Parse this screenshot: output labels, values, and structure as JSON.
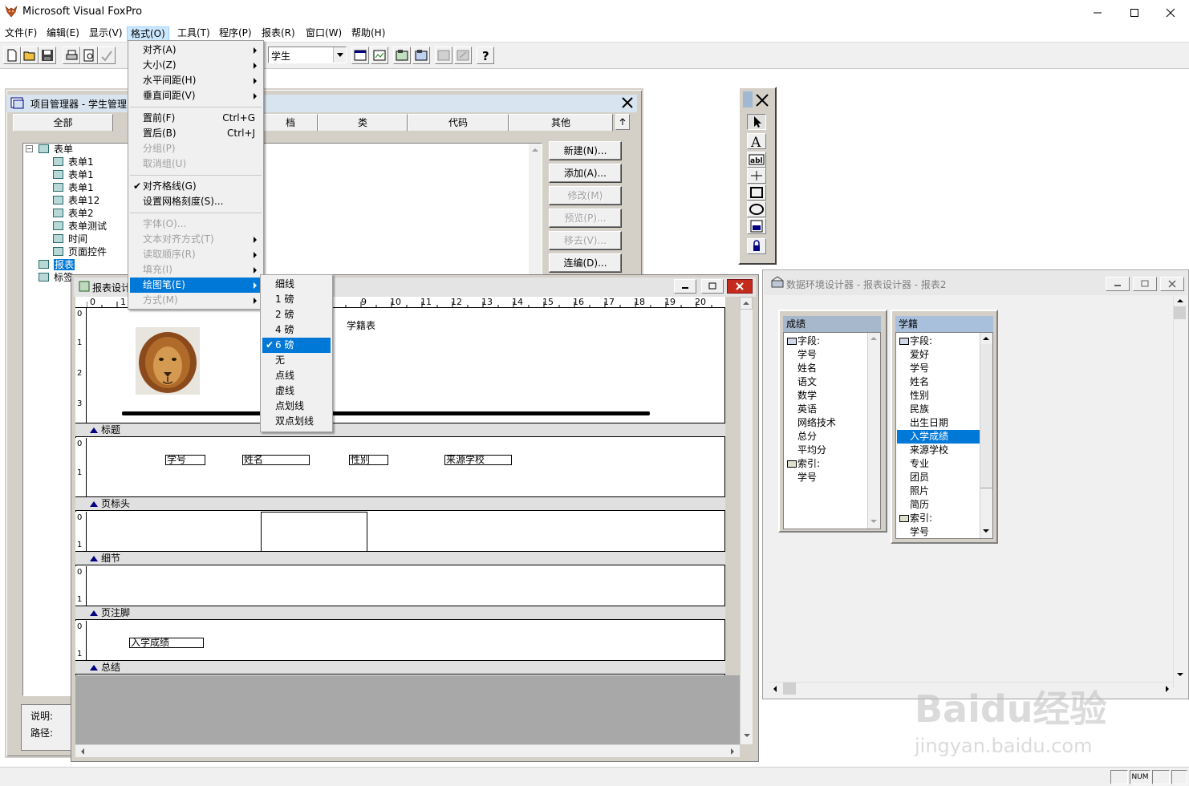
{
  "app": {
    "title": "Microsoft Visual FoxPro"
  },
  "menubar": {
    "items": [
      "文件(F)",
      "编辑(E)",
      "显示(V)",
      "格式(O)",
      "工具(T)",
      "程序(P)",
      "报表(R)",
      "窗口(W)",
      "帮助(H)"
    ]
  },
  "toolbar": {
    "combo_value": "学生"
  },
  "format_menu": {
    "items": [
      {
        "label": "对齐(A)",
        "submenu": true
      },
      {
        "label": "大小(Z)",
        "submenu": true
      },
      {
        "label": "水平间距(H)",
        "submenu": true
      },
      {
        "label": "垂直间距(V)",
        "submenu": true
      },
      {
        "label": "置前(F)",
        "shortcut": "Ctrl+G"
      },
      {
        "label": "置后(B)",
        "shortcut": "Ctrl+J"
      },
      {
        "label": "分组(P)",
        "disabled": true
      },
      {
        "label": "取消组(U)",
        "disabled": true
      },
      {
        "label": "对齐格线(G)",
        "checked": true
      },
      {
        "label": "设置网格刻度(S)..."
      },
      {
        "label": "字体(O)...",
        "disabled": true
      },
      {
        "label": "文本对齐方式(T)",
        "disabled": true,
        "submenu": true
      },
      {
        "label": "读取顺序(R)",
        "disabled": true,
        "submenu": true
      },
      {
        "label": "填充(I)",
        "disabled": true,
        "submenu": true
      },
      {
        "label": "绘图笔(E)",
        "submenu": true,
        "highlighted": true
      },
      {
        "label": "方式(M)",
        "disabled": true,
        "submenu": true
      }
    ]
  },
  "pen_submenu": {
    "items": [
      "细线",
      "1 磅",
      "2 磅",
      "4 磅",
      "6 磅",
      "无",
      "点线",
      "虚线",
      "点划线",
      "双点划线"
    ],
    "selected": "6 磅"
  },
  "project_manager": {
    "title": "项目管理器 - 学生管理",
    "tabs": [
      "全部",
      "档",
      "类",
      "代码",
      "其他"
    ],
    "tree": [
      {
        "label": "表单",
        "level": 0
      },
      {
        "label": "表单1",
        "level": 1
      },
      {
        "label": "表单1",
        "level": 1
      },
      {
        "label": "表单1",
        "level": 1
      },
      {
        "label": "表单12",
        "level": 1
      },
      {
        "label": "表单2",
        "level": 1
      },
      {
        "label": "表单测试",
        "level": 1
      },
      {
        "label": "时间",
        "level": 1
      },
      {
        "label": "页面控件",
        "level": 1
      },
      {
        "label": "报表",
        "level": 0,
        "selected": true
      },
      {
        "label": "标签",
        "level": 0
      }
    ],
    "buttons": [
      {
        "label": "新建(N)...",
        "disabled": false
      },
      {
        "label": "添加(A)...",
        "disabled": false
      },
      {
        "label": "修改(M)",
        "disabled": true
      },
      {
        "label": "预览(P)...",
        "disabled": true
      },
      {
        "label": "移去(V)...",
        "disabled": true
      },
      {
        "label": "连编(D)...",
        "disabled": false
      }
    ],
    "desc_label": "说明:",
    "path_label": "路径:"
  },
  "report_designer": {
    "title": "报表设计",
    "ruler_numbers": [
      "0",
      "1",
      "9",
      "10",
      "11",
      "12",
      "13",
      "14",
      "15",
      "16",
      "17",
      "18",
      "19",
      "20"
    ],
    "report_title_text": "学籍表",
    "bands": [
      "标题",
      "页标头",
      "细节",
      "页注脚",
      "总结"
    ],
    "header_fields": [
      "学号",
      "姓名",
      "性别",
      "来源学校"
    ],
    "summary_field": "入学成绩",
    "vruler_title": [
      "0",
      "1",
      "2",
      "3"
    ],
    "vruler_small": [
      "0",
      "1"
    ]
  },
  "data_env": {
    "title": "数据环境设计器 - 报表设计器 - 报表2",
    "tables": [
      {
        "name": "成绩",
        "rows": [
          "字段:",
          "学号",
          "姓名",
          "语文",
          "数学",
          "英语",
          "网络技术",
          "总分",
          "平均分",
          "索引:",
          "学号"
        ]
      },
      {
        "name": "学籍",
        "rows": [
          "字段:",
          "爱好",
          "学号",
          "姓名",
          "性别",
          "民族",
          "出生日期",
          "入学成绩",
          "来源学校",
          "专业",
          "团员",
          "照片",
          "简历",
          "索引:",
          "学号"
        ],
        "selected": "入学成绩"
      }
    ]
  },
  "statusbar": {
    "num": "NUM"
  },
  "watermark": {
    "logo_text": "Baidu经验",
    "url": "jingyan.baidu.com"
  },
  "colors": {
    "highlight": "#0078d7",
    "menu_active": "#cce8ff",
    "table_header": "#a8c0dc"
  }
}
